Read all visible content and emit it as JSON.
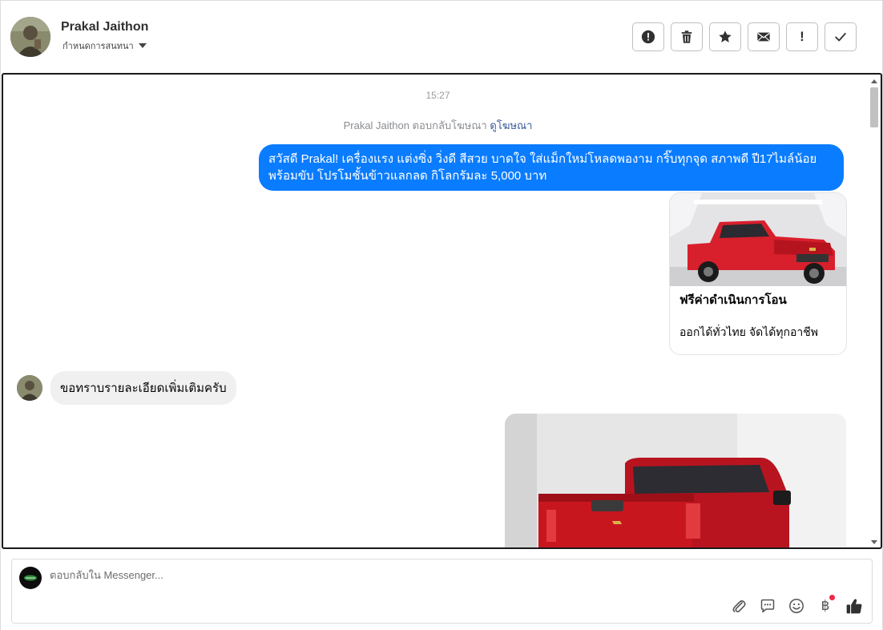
{
  "header": {
    "contact_name": "Prakal Jaithon",
    "assign_label": "กำหนดการสนทนา",
    "actions": [
      {
        "name": "report-button",
        "icon": "alert-circle-icon"
      },
      {
        "name": "delete-button",
        "icon": "trash-icon"
      },
      {
        "name": "star-button",
        "icon": "star-icon"
      },
      {
        "name": "mark-unread-button",
        "icon": "envelope-icon"
      },
      {
        "name": "mark-important-button",
        "icon": "exclamation-icon",
        "glyph": "!"
      },
      {
        "name": "mark-done-button",
        "icon": "check-icon"
      }
    ]
  },
  "thread": {
    "time": "15:27",
    "ad_reply_text": "Prakal Jaithon ตอบกลับโฆษณา",
    "ad_link": "ดูโฆษณา",
    "outgoing_message": "สวัสดี Prakal! เครื่องแรง แต่งซิ่ง วิ่งดี สีสวย บาดใจ ใส่แม็กใหม่โหลดพองาม กริ๊บทุกจุด สภาพดี ปี17ไมล์น้อย พร้อมขับ โปรโมชั้นข้าวแลกลด กิโลกรัมละ 5,000 บาท",
    "card": {
      "title": "ฟรีค่าดำเนินการโอน",
      "subtitle": "ออกได้ทั่วไทย จัดได้ทุกอาชีพ"
    },
    "incoming_message": "ขอทราบรายละเอียดเพิ่มเติมครับ"
  },
  "composer": {
    "placeholder": "ตอบกลับใน Messenger...",
    "tools": [
      "paperclip-icon",
      "saved-reply-icon",
      "emoji-icon",
      "baht-icon",
      "thumbs-up-icon"
    ],
    "baht_glyph": "฿",
    "notification_color": "#f02849"
  },
  "colors": {
    "outgoing_bubble": "#0a7cff",
    "incoming_bubble": "#f0f0f0",
    "link": "#385898"
  }
}
